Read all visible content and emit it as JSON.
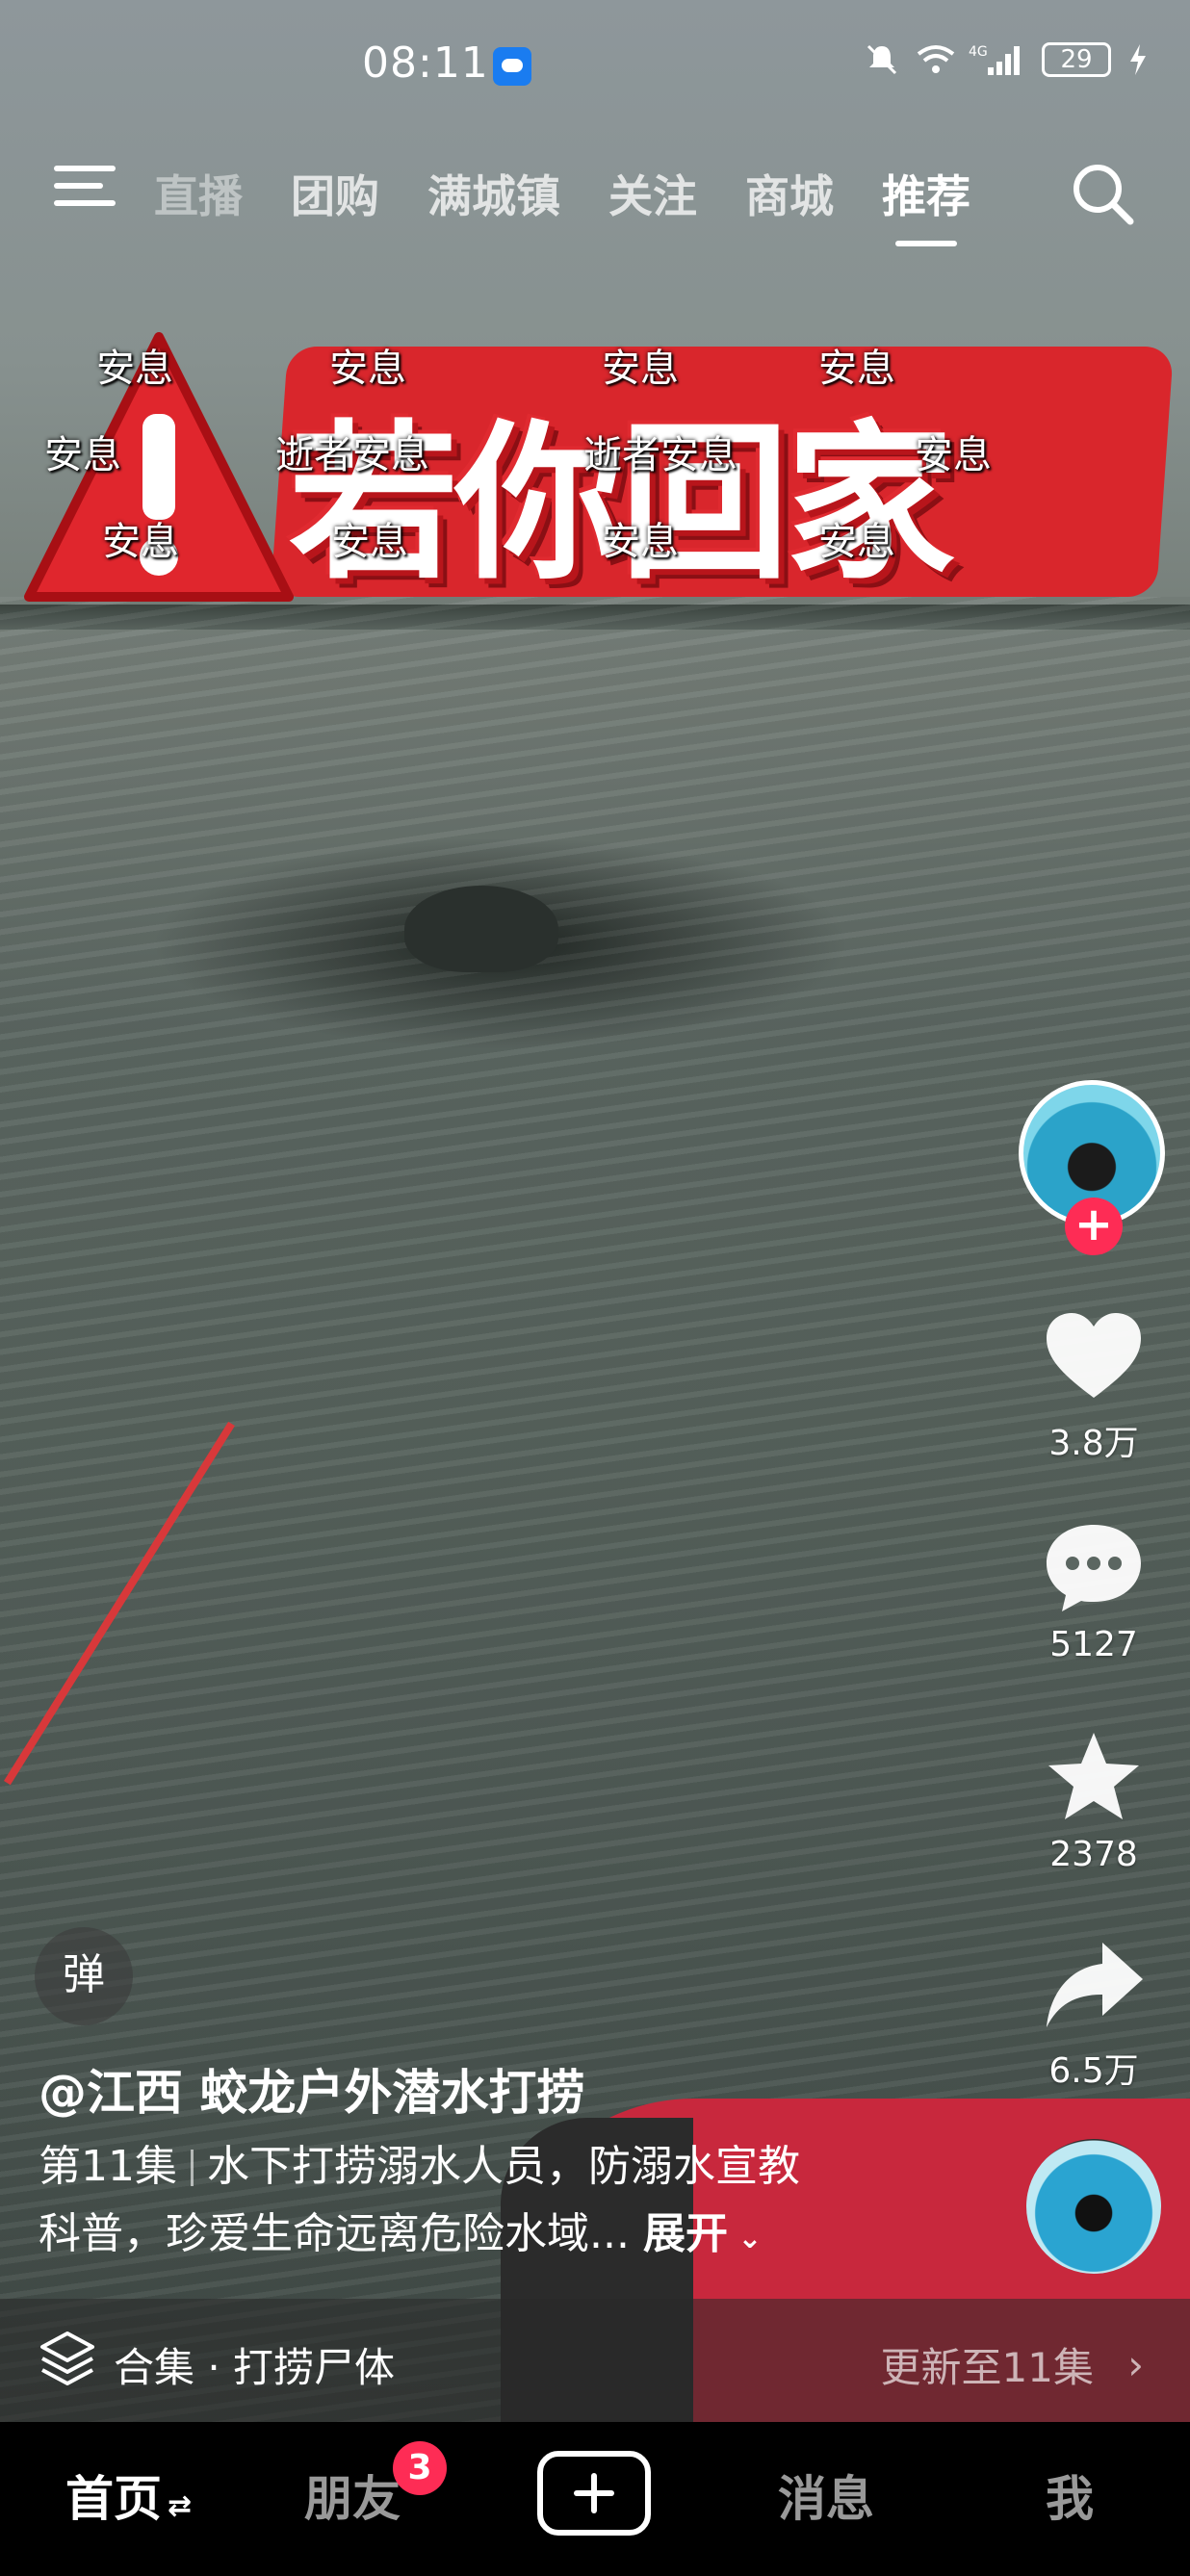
{
  "status_bar": {
    "time": "08:11",
    "network": "4G",
    "battery": "29"
  },
  "top_nav": {
    "tabs": [
      "直播",
      "团购",
      "满城镇",
      "关注",
      "商城",
      "推荐"
    ],
    "active_tab": "推荐"
  },
  "banner": {
    "title": "若你回家"
  },
  "watermarks": [
    "安息",
    "安息",
    "安息",
    "安息",
    "安息",
    "逝者安息",
    "逝者安息",
    "安息",
    "安息",
    "安息",
    "安息",
    "安息"
  ],
  "sidebar": {
    "like_count": "3.8万",
    "comment_count": "5127",
    "favorite_count": "2378",
    "share_count": "6.5万"
  },
  "video_info": {
    "danmu_label": "弹",
    "author": "@江西 蛟龙户外潜水打捞",
    "episode": "第11集",
    "description_line1": "水下打捞溺水人员，防溺水宣教",
    "description_line2": "科普，珍爱生命远离危险水域...",
    "expand_label": "展开"
  },
  "collection": {
    "label": "合集 · 打捞尸体",
    "update_text": "更新至11集"
  },
  "tab_bar": {
    "home": "首页",
    "friends": "朋友",
    "friends_badge": "3",
    "messages": "消息",
    "me": "我"
  },
  "colors": {
    "accent_red": "#fe2c55",
    "banner_red": "#d9262c"
  }
}
